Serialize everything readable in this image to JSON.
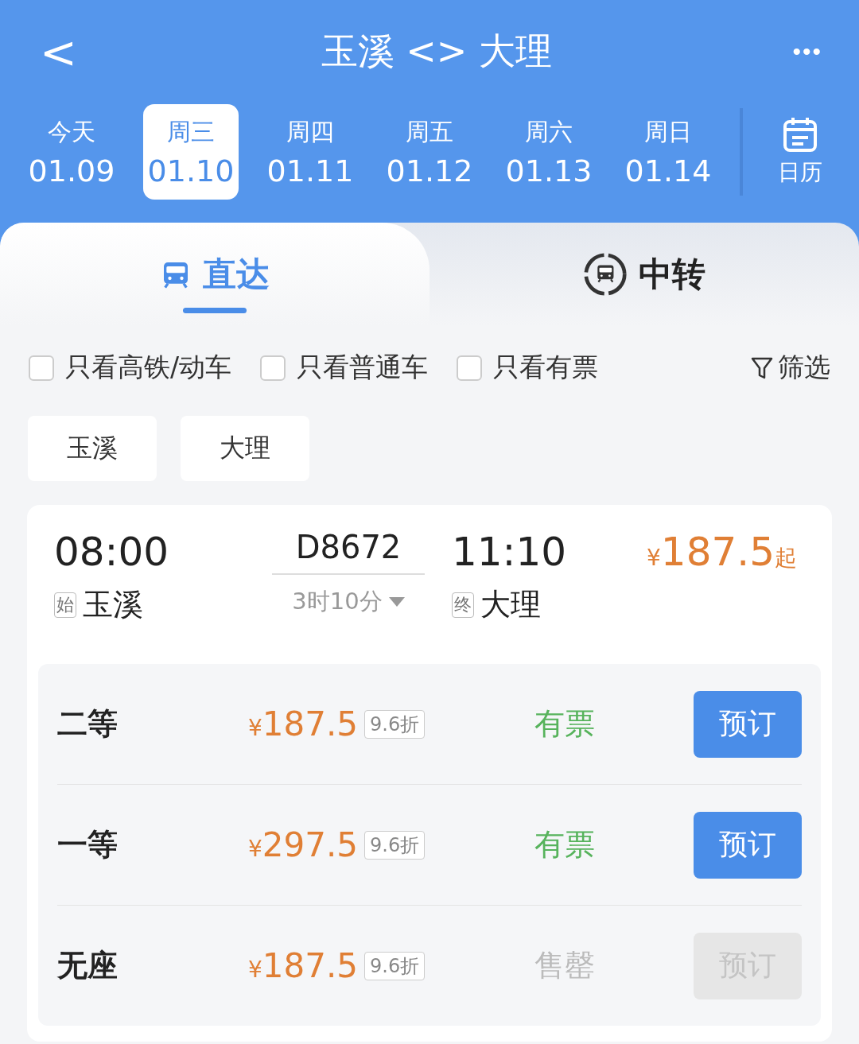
{
  "header": {
    "back": "<",
    "title": "玉溪 <> 大理",
    "more": "•••"
  },
  "dates": [
    {
      "weekday": "今天",
      "date": "01.09",
      "selected": false
    },
    {
      "weekday": "周三",
      "date": "01.10",
      "selected": true
    },
    {
      "weekday": "周四",
      "date": "01.11",
      "selected": false
    },
    {
      "weekday": "周五",
      "date": "01.12",
      "selected": false
    },
    {
      "weekday": "周六",
      "date": "01.13",
      "selected": false
    },
    {
      "weekday": "周日",
      "date": "01.14",
      "selected": false
    }
  ],
  "calendar": {
    "label": "日历"
  },
  "tabs": [
    {
      "label": "直达",
      "kind": "direct",
      "selected": true
    },
    {
      "label": "中转",
      "kind": "transfer",
      "selected": false
    }
  ],
  "filters": [
    {
      "label": "只看高铁/动车",
      "checked": false
    },
    {
      "label": "只看普通车",
      "checked": false
    },
    {
      "label": "只看有票",
      "checked": false
    }
  ],
  "filter_button": "筛选",
  "stations": [
    "玉溪",
    "大理"
  ],
  "train": {
    "depart_time": "08:00",
    "depart_tag": "始",
    "depart_station": "玉溪",
    "number": "D8672",
    "duration": "3时10分",
    "arrive_time": "11:10",
    "arrive_tag": "终",
    "arrive_station": "大理",
    "price_symbol": "¥",
    "price": "187.5",
    "price_suffix": "起",
    "seats": [
      {
        "class": "二等",
        "symbol": "¥",
        "price": "187.5",
        "discount": "9.6折",
        "status": "有票",
        "available": true,
        "button": "预订",
        "disabled": false
      },
      {
        "class": "一等",
        "symbol": "¥",
        "price": "297.5",
        "discount": "9.6折",
        "status": "有票",
        "available": true,
        "button": "预订",
        "disabled": false
      },
      {
        "class": "无座",
        "symbol": "¥",
        "price": "187.5",
        "discount": "9.6折",
        "status": "售罄",
        "available": false,
        "button": "预订",
        "disabled": true
      }
    ]
  }
}
